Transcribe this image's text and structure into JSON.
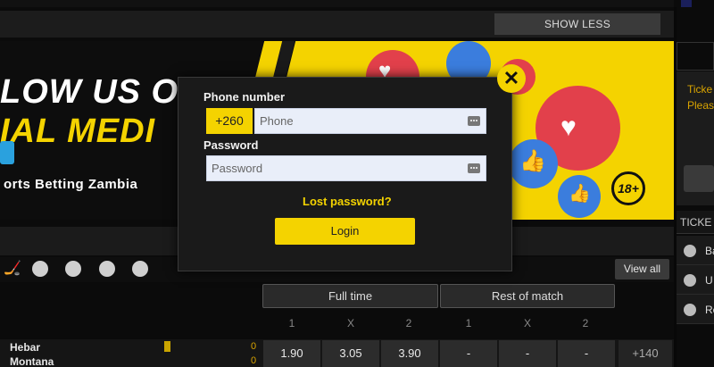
{
  "header": {
    "show_less": "SHOW LESS"
  },
  "banner": {
    "headline1": "LOW US O",
    "headline2": "IAL MEDI",
    "subtitle": "orts Betting Zambia",
    "age_badge": "18+"
  },
  "sports": {
    "view_all": "View all",
    "market_tabs": [
      "Full time",
      "Rest of match"
    ],
    "col_headers": [
      "1",
      "X",
      "2",
      "1",
      "X",
      "2"
    ]
  },
  "match": {
    "team1": "Hebar",
    "team2": "Montana",
    "score1": "0",
    "score2": "0",
    "odds": [
      "1.90",
      "3.05",
      "3.90",
      "-",
      "-",
      "-"
    ],
    "more": "+140"
  },
  "right_sidebar": {
    "text1": "Ticke",
    "text2": "Pleas",
    "tab": "TICKE",
    "items": [
      "Ba",
      "U",
      "Re"
    ]
  },
  "login_modal": {
    "close": "✕",
    "phone_label": "Phone number",
    "prefix": "+260",
    "phone_placeholder": "Phone",
    "password_label": "Password",
    "password_placeholder": "Password",
    "lost_password": "Lost password?",
    "login_label": "Login"
  },
  "colors": {
    "accent": "#f4d300",
    "background": "#0b0b0b"
  }
}
